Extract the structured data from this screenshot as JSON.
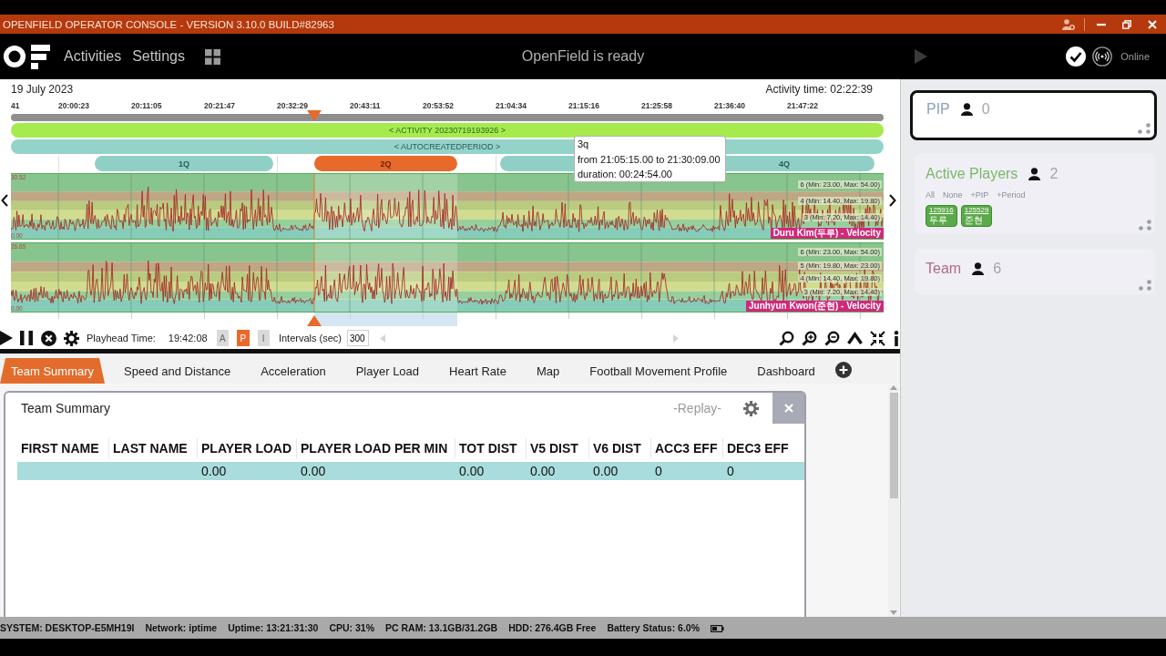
{
  "title_bar": {
    "title": "OPENFIELD OPERATOR CONSOLE - VERSION 3.10.0 BUILD#82963"
  },
  "header": {
    "nav": [
      {
        "label": "Activities"
      },
      {
        "label": "Settings"
      }
    ],
    "status": "OpenField is ready",
    "connection": "Online"
  },
  "timeline": {
    "date": "19 July 2023",
    "activity_time": "Activity time: 02:22:39",
    "ticks": [
      "41",
      "20:00:23",
      "20:11:05",
      "20:21:47",
      "20:32:29",
      "20:43:11",
      "20:53:52",
      "21:04:34",
      "21:15:16",
      "21:25:58",
      "21:36:40",
      "21:47:22"
    ],
    "activity_bar": "< ACTIVITY 20230719193926 >",
    "period_bar": "< AUTOCREATEDPERIOD >",
    "periods": [
      {
        "label": "1Q",
        "selected": false
      },
      {
        "label": "2Q",
        "selected": true
      },
      {
        "selected": false
      },
      {
        "label": "4Q",
        "selected": false
      }
    ],
    "tooltip": {
      "title": "3q",
      "range": "from 21:05:15.00 to 21:30:09.00",
      "duration": "duration: 00:24:54.00"
    },
    "charts": [
      {
        "y_max": "30.52",
        "y_min": "0.00",
        "zones": [
          "6 (Min: 23.00, Max: 54.00)",
          "4 (Min: 14.40, Max: 19.80)",
          "3 (Min: 7.20, Max: 14.40)"
        ],
        "player": "Duru Kim(두루) - Velocity"
      },
      {
        "y_max": "26.65",
        "y_min": "0.00",
        "zones": [
          "6 (Min: 23.00, Max: 54.00)",
          "5 (Min: 19.80, Max: 23.00)",
          "4 (Min: 14.40, Max: 19.80)",
          "3 (Min: 7.20, Max: 14.40)"
        ],
        "player": "Junhyun Kwon(준현) - Velocity"
      }
    ]
  },
  "toolbar": {
    "playhead_label": "Playhead Time:",
    "playhead_time": "19:42:08",
    "modes": [
      {
        "label": "A",
        "selected": false
      },
      {
        "label": "P",
        "selected": true
      },
      {
        "label": "I",
        "selected": false
      }
    ],
    "intervals_label": "Intervals (sec)",
    "intervals_value": "300"
  },
  "tabs": [
    {
      "label": "Team Summary",
      "selected": true
    },
    {
      "label": "Speed and Distance",
      "selected": false
    },
    {
      "label": "Acceleration",
      "selected": false
    },
    {
      "label": "Player Load",
      "selected": false
    },
    {
      "label": "Heart Rate",
      "selected": false
    },
    {
      "label": "Map",
      "selected": false
    },
    {
      "label": "Football Movement Profile",
      "selected": false
    },
    {
      "label": "Dashboard",
      "selected": false
    }
  ],
  "widget": {
    "title": "Team Summary",
    "mode": "-Replay-",
    "columns": [
      "FIRST NAME",
      "LAST NAME",
      "PLAYER LOAD",
      "PLAYER LOAD PER MIN",
      "TOT DIST",
      "V5 DIST",
      "V6 DIST",
      "ACC3 EFF",
      "DEC3 EFF"
    ],
    "rows": [
      {
        "cells": [
          null,
          null,
          "0.00",
          "0.00",
          "0.00",
          "0.00",
          "0.00",
          "0",
          "0"
        ]
      }
    ]
  },
  "side_panel": {
    "groups": [
      {
        "kind": "pip",
        "title": "PIP",
        "count": "0",
        "selected": true
      },
      {
        "kind": "active",
        "title": "Active Players",
        "count": "2",
        "selected": false,
        "filters": [
          "All",
          "None",
          "+PIP",
          "+Period"
        ],
        "players": [
          {
            "number": "125916",
            "name": "두루"
          },
          {
            "number": "125529",
            "name": "준현"
          }
        ]
      },
      {
        "kind": "team",
        "title": "Team",
        "count": "6",
        "selected": false
      }
    ]
  },
  "status_bar": {
    "items": [
      "SYSTEM: DESKTOP-E5MH19I",
      "Network: iptime",
      "Uptime: 13:21:31:30",
      "CPU: 31%",
      "PC RAM: 13.1GB/31.2GB",
      "HDD: 276.4GB Free",
      "Battery Status: 6.0%"
    ]
  }
}
